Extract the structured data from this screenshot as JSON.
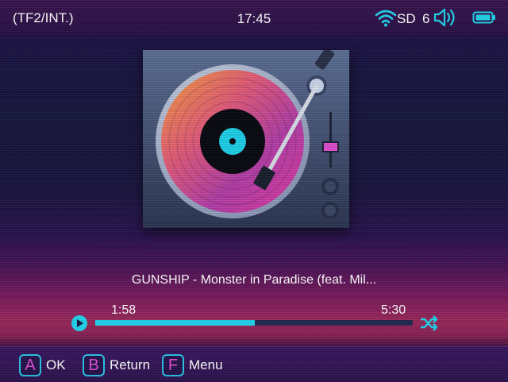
{
  "status": {
    "storage": "(TF2/INT.)",
    "clock": "17:45",
    "sd": "SD",
    "volume_level": "6"
  },
  "track": {
    "title": "GUNSHIP - Monster in Paradise (feat. Mil...",
    "elapsed": "1:58",
    "total": "5:30",
    "progress": 0.502
  },
  "hints": [
    {
      "key": "A",
      "label": "OK"
    },
    {
      "key": "B",
      "label": "Return"
    },
    {
      "key": "F",
      "label": "Menu"
    }
  ],
  "colors": {
    "accent": "#22d6ee",
    "key_letter": "#e04fd0"
  },
  "icons": [
    "wifi-icon",
    "volume-icon",
    "battery-icon",
    "play-icon",
    "shuffle-icon"
  ]
}
